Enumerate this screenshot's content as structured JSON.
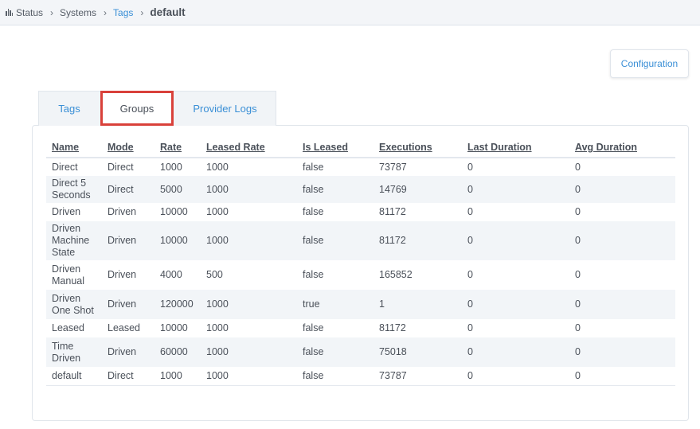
{
  "breadcrumb": {
    "items": [
      {
        "label": "Status",
        "icon": "bar-chart-icon"
      },
      {
        "label": "Systems"
      },
      {
        "label": "Tags"
      },
      {
        "label": "default"
      }
    ],
    "separator": "›"
  },
  "toolbar": {
    "configuration_label": "Configuration"
  },
  "tabs": [
    {
      "label": "Tags",
      "active": false
    },
    {
      "label": "Groups",
      "active": true
    },
    {
      "label": "Provider Logs",
      "active": false
    }
  ],
  "table": {
    "columns": [
      "Name",
      "Mode",
      "Rate",
      "Leased Rate",
      "Is Leased",
      "Executions",
      "Last Duration",
      "Avg Duration"
    ],
    "rows": [
      [
        "Direct",
        "Direct",
        "1000",
        "1000",
        "false",
        "73787",
        "0",
        "0"
      ],
      [
        "Direct 5 Seconds",
        "Direct",
        "5000",
        "1000",
        "false",
        "14769",
        "0",
        "0"
      ],
      [
        "Driven",
        "Driven",
        "10000",
        "1000",
        "false",
        "81172",
        "0",
        "0"
      ],
      [
        "Driven Machine State",
        "Driven",
        "10000",
        "1000",
        "false",
        "81172",
        "0",
        "0"
      ],
      [
        "Driven Manual",
        "Driven",
        "4000",
        "500",
        "false",
        "165852",
        "0",
        "0"
      ],
      [
        "Driven One Shot",
        "Driven",
        "120000",
        "1000",
        "true",
        "1",
        "0",
        "0"
      ],
      [
        "Leased",
        "Leased",
        "10000",
        "1000",
        "false",
        "81172",
        "0",
        "0"
      ],
      [
        "Time Driven",
        "Driven",
        "60000",
        "1000",
        "false",
        "75018",
        "0",
        "0"
      ],
      [
        "default",
        "Direct",
        "1000",
        "1000",
        "false",
        "73787",
        "0",
        "0"
      ]
    ]
  },
  "colors": {
    "accent": "#3a8fd6",
    "active_tab_outline": "#d9413a",
    "stripe": "#f2f5f8"
  }
}
